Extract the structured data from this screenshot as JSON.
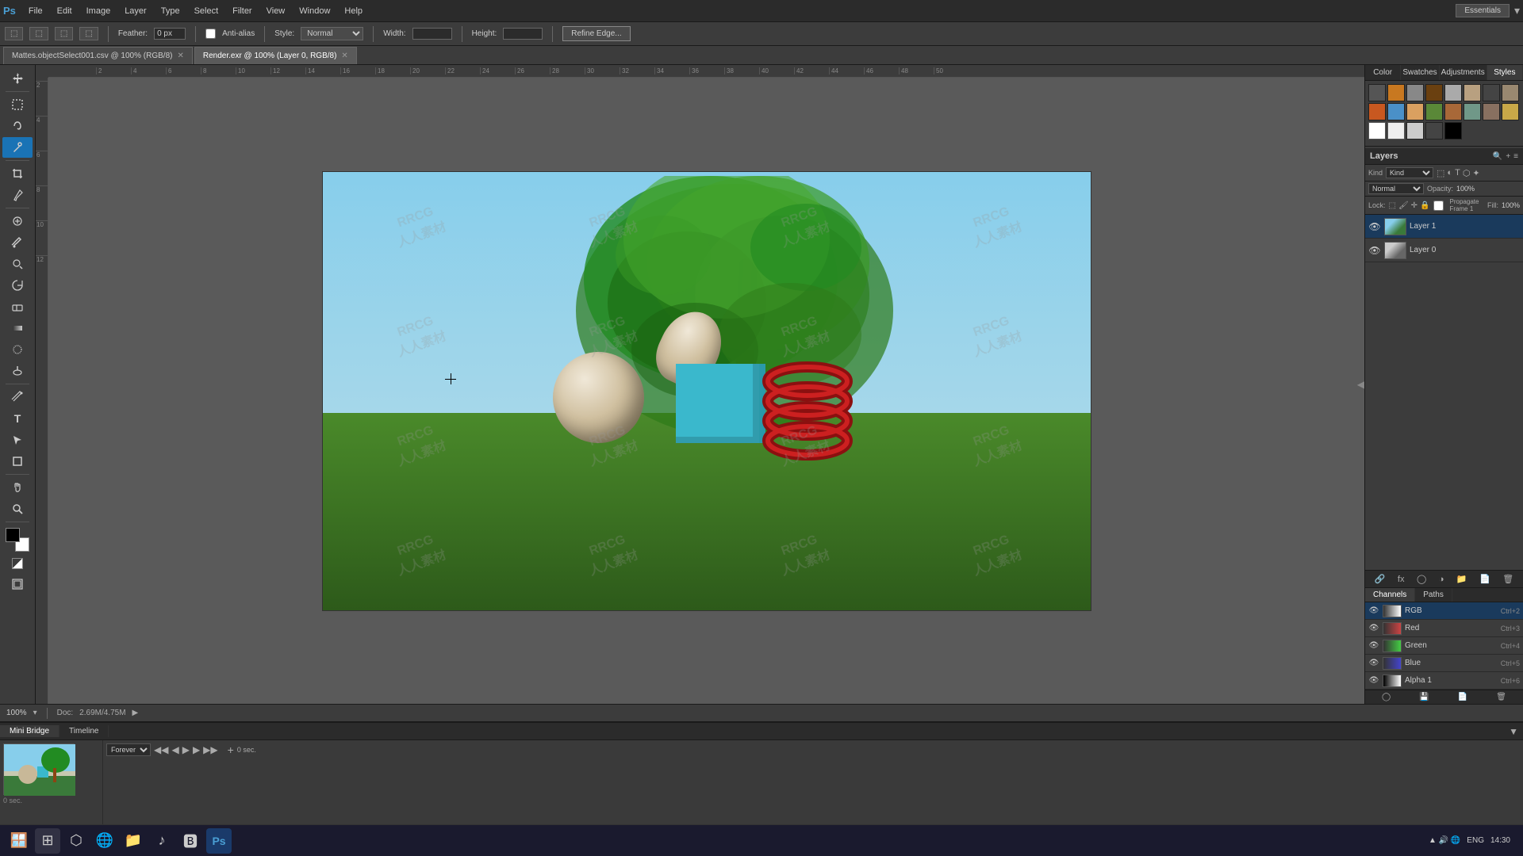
{
  "app": {
    "logo": "Ps",
    "workspace": "Essentials"
  },
  "menubar": {
    "items": [
      "File",
      "Edit",
      "Image",
      "Layer",
      "Type",
      "Select",
      "Filter",
      "View",
      "Window",
      "Help"
    ]
  },
  "optionsbar": {
    "feather_label": "Feather:",
    "feather_value": "0 px",
    "antialias_label": "Anti-alias",
    "style_label": "Style:",
    "style_value": "Normal",
    "width_label": "Width:",
    "height_label": "Height:",
    "refine_btn": "Refine Edge..."
  },
  "tabs": [
    {
      "name": "Mattes.objectSelect001.csv @ 100% (RGB/8)",
      "active": false,
      "closeable": true
    },
    {
      "name": "Render.exr @ 100% (Layer 0, RGB/8)",
      "active": true,
      "closeable": true
    }
  ],
  "ruler": {
    "marks": [
      "2",
      "4",
      "6",
      "8",
      "10",
      "12",
      "14",
      "16",
      "18",
      "20",
      "22",
      "24",
      "26",
      "28",
      "30",
      "32",
      "34",
      "36",
      "38",
      "40",
      "42",
      "44",
      "46",
      "48",
      "50"
    ]
  },
  "toolbar": {
    "tools": [
      {
        "id": "move",
        "icon": "✛",
        "active": false
      },
      {
        "id": "marquee",
        "icon": "⬚",
        "active": false
      },
      {
        "id": "lasso",
        "icon": "⌇",
        "active": false
      },
      {
        "id": "magic-wand",
        "icon": "⌇",
        "active": false
      },
      {
        "id": "crop",
        "icon": "⊡",
        "active": false
      },
      {
        "id": "eyedropper",
        "icon": "✏",
        "active": false
      },
      {
        "id": "spot-heal",
        "icon": "⊕",
        "active": false
      },
      {
        "id": "brush",
        "icon": "✏",
        "active": false
      },
      {
        "id": "clone",
        "icon": "⊕",
        "active": false
      },
      {
        "id": "eraser",
        "icon": "◻",
        "active": false
      },
      {
        "id": "gradient",
        "icon": "▦",
        "active": false
      },
      {
        "id": "blur",
        "icon": "○",
        "active": false
      },
      {
        "id": "dodge",
        "icon": "○",
        "active": false
      },
      {
        "id": "pen",
        "icon": "✒",
        "active": false
      },
      {
        "id": "type",
        "icon": "T",
        "active": false
      },
      {
        "id": "path-select",
        "icon": "↖",
        "active": false
      },
      {
        "id": "shape",
        "icon": "◻",
        "active": false
      },
      {
        "id": "hand",
        "icon": "✋",
        "active": false
      },
      {
        "id": "zoom",
        "icon": "🔍",
        "active": false
      }
    ]
  },
  "right_panel": {
    "tabs": [
      "Color",
      "Swatches",
      "Adjustments",
      "Styles"
    ],
    "active_tab": "Styles",
    "color_swatches": [
      "#ff0000",
      "#ff8800",
      "#ffff00",
      "#00ff00",
      "#00ffff",
      "#0000ff",
      "#ff00ff",
      "#ffffff",
      "#cc0000",
      "#cc8800",
      "#cccc00",
      "#00cc00",
      "#00cccc",
      "#0000cc",
      "#cc00cc",
      "#cccccc",
      "#880000",
      "#884400",
      "#888800",
      "#008800",
      "#008888",
      "#000088",
      "#880088",
      "#888888",
      "#000000",
      "#333333"
    ]
  },
  "layers_panel": {
    "title": "Layers",
    "filter_label": "Kind",
    "blend_mode": "Normal",
    "opacity_label": "Opacity:",
    "opacity_value": "100%",
    "lock_label": "Lock:",
    "fill_label": "Fill:",
    "fill_value": "100%",
    "propagate_label": "Propagate Frame 1",
    "layers": [
      {
        "id": "layer1",
        "name": "Layer 1",
        "visible": true,
        "active": true
      },
      {
        "id": "layer0",
        "name": "Layer 0",
        "visible": true,
        "active": false
      }
    ]
  },
  "channels_panel": {
    "tabs": [
      "Channels",
      "Paths"
    ],
    "active_tab": "Channels",
    "channels": [
      {
        "name": "RGB",
        "shortcut": "Ctrl+2",
        "visible": true,
        "active": true,
        "color": "#888"
      },
      {
        "name": "Red",
        "shortcut": "Ctrl+3",
        "visible": true,
        "active": false,
        "color": "#cc4444"
      },
      {
        "name": "Green",
        "shortcut": "Ctrl+4",
        "visible": true,
        "active": false,
        "color": "#44cc44"
      },
      {
        "name": "Blue",
        "shortcut": "Ctrl+5",
        "visible": true,
        "active": false,
        "color": "#4444cc"
      },
      {
        "name": "Alpha 1",
        "shortcut": "Ctrl+6",
        "visible": true,
        "active": false,
        "color": "#aaa"
      }
    ]
  },
  "statusbar": {
    "zoom": "100%",
    "doc_label": "Doc:",
    "doc_value": "2.69M/4.75M"
  },
  "bottom_panel": {
    "tabs": [
      "Mini Bridge",
      "Timeline"
    ],
    "active_tab": "Mini Bridge",
    "timeline": {
      "time_value": "0 sec.",
      "loop_label": "Forever",
      "controls": [
        "◀◀",
        "◀",
        "▶",
        "▶▶"
      ]
    }
  },
  "taskbar": {
    "system_icons": [
      "🪟",
      "⬜",
      "🌐",
      "📁",
      "♪",
      "✉"
    ],
    "tray": "ENG",
    "clock": "14:30"
  },
  "watermark": {
    "text1": "RRCG",
    "text2": "人人素材"
  }
}
